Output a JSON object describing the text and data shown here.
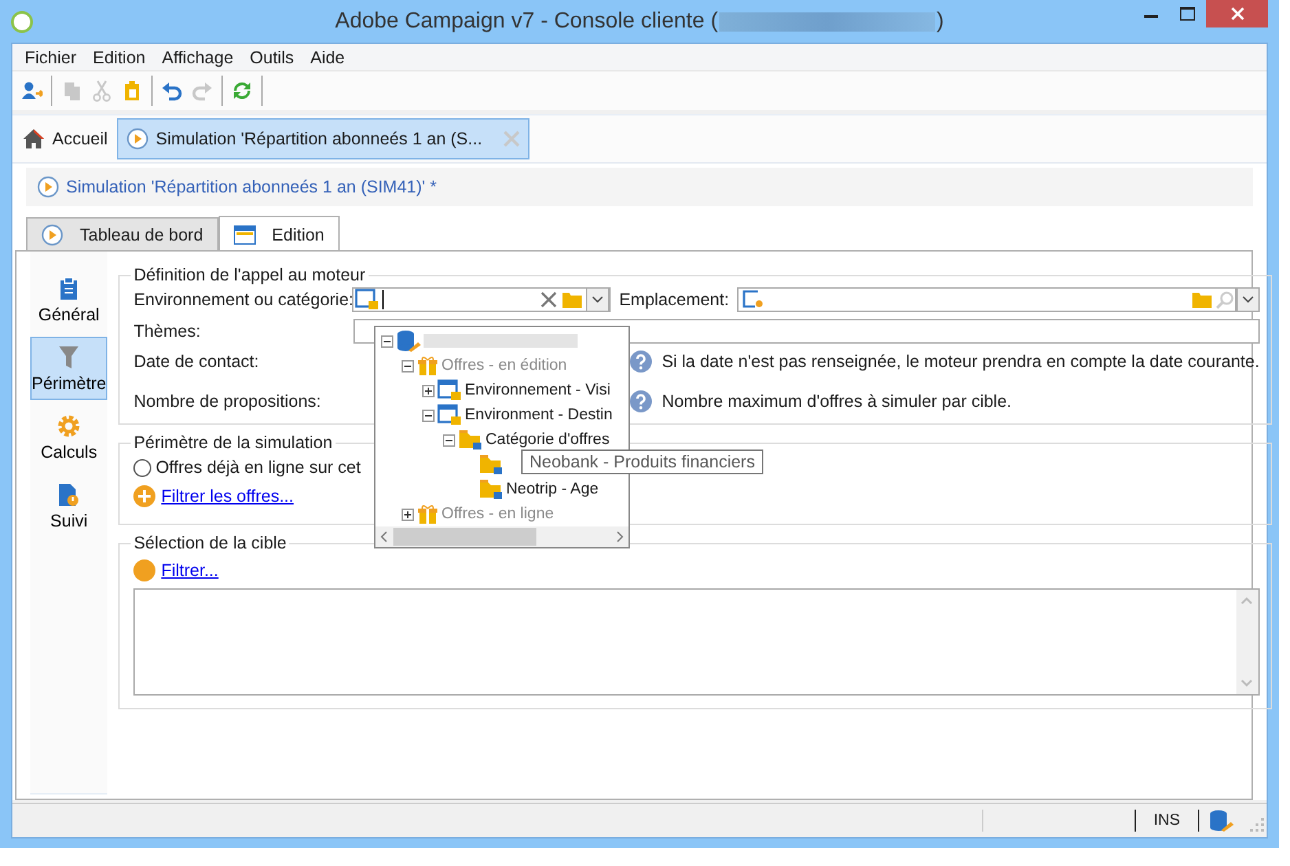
{
  "window": {
    "title": "Adobe Campaign v7 - Console cliente (",
    "title_end": ")"
  },
  "menu": [
    "Fichier",
    "Edition",
    "Affichage",
    "Outils",
    "Aide"
  ],
  "toolbar": [
    {
      "kind": "add-user",
      "disabled": false
    },
    {
      "kind": "copy",
      "disabled": true
    },
    {
      "kind": "cut",
      "disabled": true
    },
    {
      "kind": "paste",
      "disabled": false
    },
    {
      "kind": "undo",
      "disabled": false
    },
    {
      "kind": "redo",
      "disabled": true
    },
    {
      "kind": "refresh",
      "disabled": false
    }
  ],
  "doc_tabs": [
    {
      "kind": "home",
      "label": "Accueil",
      "selected": false
    },
    {
      "kind": "simulation",
      "label": "Simulation 'Répartition abonneés 1 an (S...",
      "selected": true
    }
  ],
  "breadcrumb": "Simulation 'Répartition abonneés 1 an (SIM41)' *",
  "view_tabs": [
    {
      "kind": "dashboard",
      "label": "Tableau de bord",
      "selected": false
    },
    {
      "kind": "edition",
      "label": "Edition",
      "selected": true
    }
  ],
  "sidebar": {
    "items": [
      {
        "kind": "general",
        "label": "Général",
        "selected": false
      },
      {
        "kind": "scope",
        "label": "Périmètre",
        "selected": true
      },
      {
        "kind": "calc",
        "label": "Calculs",
        "selected": false
      },
      {
        "kind": "tracking",
        "label": "Suivi",
        "selected": false
      }
    ]
  },
  "engine_call": {
    "title": "Définition de l'appel au moteur",
    "environment": {
      "label": "Environnement ou catégorie:"
    },
    "location": {
      "label": "Emplacement:"
    },
    "themes": {
      "label": "Thèmes:"
    },
    "contact_date": {
      "label": "Date de contact:",
      "help": "Si la date n'est pas renseignée, le moteur prendra en compte la date courante."
    },
    "proposal_count": {
      "label": "Nombre de propositions:",
      "help": "Nombre maximum d'offres à simuler par cible."
    }
  },
  "environment_dropdown": {
    "tree": [
      {
        "kind": "database",
        "expanded": true,
        "children": [
          {
            "kind": "offers",
            "label": "Offres - en édition",
            "expanded": true,
            "children": [
              {
                "kind": "environment",
                "label": "Environnement - Visi",
                "expanded": false
              },
              {
                "kind": "environment",
                "label": "Environment - Destin",
                "expanded": true,
                "children": [
                  {
                    "kind": "category",
                    "label": "Catégorie d'offres",
                    "expanded": true,
                    "children": [
                      {
                        "kind": "category"
                      },
                      {
                        "kind": "category",
                        "label": "Neotrip - Age"
                      }
                    ]
                  }
                ]
              }
            ]
          },
          {
            "kind": "offers",
            "label": "Offres - en ligne",
            "expanded": false
          }
        ]
      }
    ]
  },
  "tooltip": "Neobank - Produits financiers",
  "scope": {
    "title": "Périmètre de la simulation",
    "option": {
      "label": "Offres déjà en ligne sur cet",
      "selected": false
    },
    "link": "Filtrer les offres..."
  },
  "target": {
    "title": "Sélection de la cible",
    "link": "Filtrer..."
  },
  "status_bar": {
    "mode": "INS"
  }
}
